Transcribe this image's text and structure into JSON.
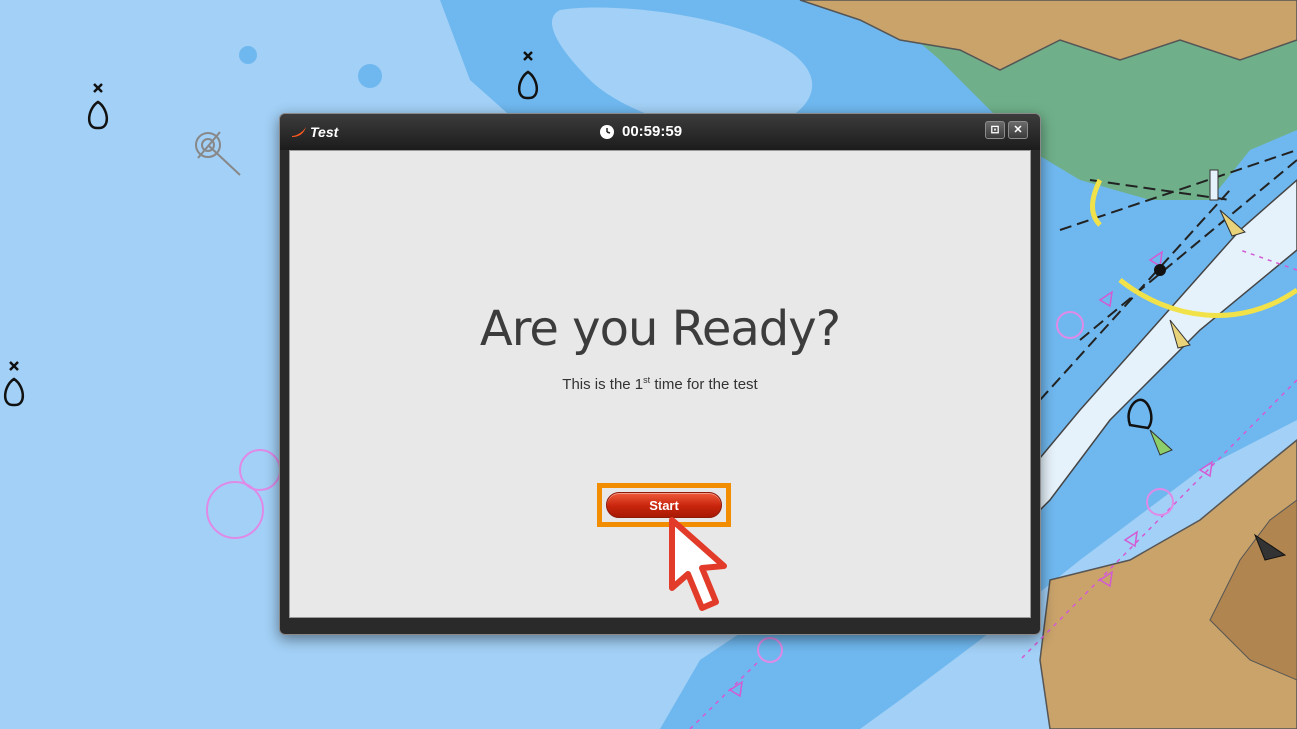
{
  "window": {
    "title": "Test",
    "timer": "00:59:59",
    "icons": [
      "app-logo-icon",
      "clock-icon",
      "restore-icon",
      "close-icon"
    ],
    "restore_glyph": "⊡",
    "close_glyph": "✕"
  },
  "dialog": {
    "heading": "Are you Ready?",
    "subtext_before": "This is the 1",
    "subtext_sup": "st",
    "subtext_after": " time for the test",
    "start_label": "Start"
  },
  "colors": {
    "deep_water": "#a2d0f6",
    "shallow_water": "#6fb8ef",
    "land": "#c9a36a",
    "intertidal": "#6fb08a",
    "highlight": "#f28c00",
    "start_button": "#c8240c",
    "pointer": "#e23b2a"
  }
}
